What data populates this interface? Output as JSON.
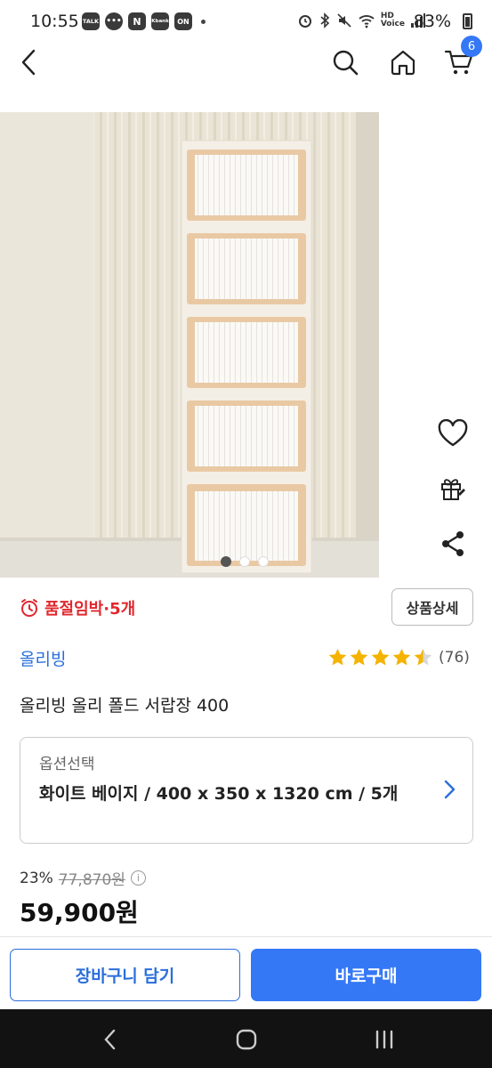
{
  "status_bar": {
    "time": "10:55",
    "notifications": [
      "TALK",
      "chat",
      "N",
      "Kbank",
      "ON"
    ],
    "battery": "83%"
  },
  "header": {
    "cart_count": "6"
  },
  "gallery": {
    "total_images": 3,
    "active_index": 0
  },
  "stock": {
    "text": "품절임박·5개"
  },
  "detail_button": "상품상세",
  "brand": "올리빙",
  "rating": {
    "stars": 4.5,
    "count": "(76)"
  },
  "product_name": "올리빙 올리 폴드 서랍장 400",
  "option": {
    "label": "옵션선택",
    "value": "화이트 베이지 / 400 x 350 x 1320 cm / 5개"
  },
  "price": {
    "discount_rate": "23%",
    "original": "77,870원",
    "sale": "59,900원"
  },
  "actions": {
    "cart": "장바구니 담기",
    "buy": "바로구매"
  },
  "colors": {
    "accent": "#3478f6",
    "brand_text": "#2a6fdb",
    "stock_red": "#e0282e",
    "star": "#f5b301"
  }
}
